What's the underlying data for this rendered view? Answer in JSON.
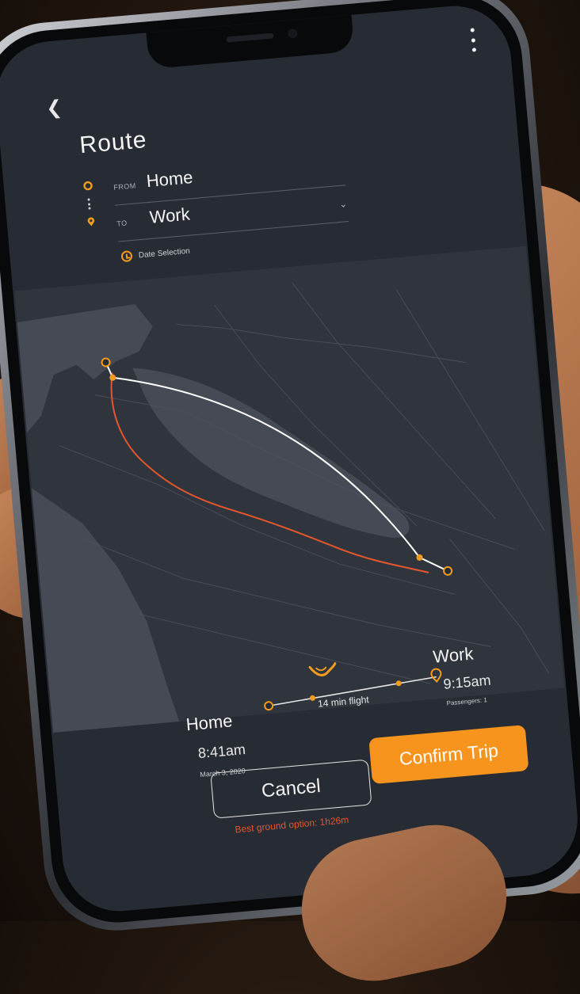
{
  "header": {
    "title": "Route"
  },
  "route": {
    "from_label": "FROM",
    "from_value": "Home",
    "to_label": "TO",
    "to_value": "Work",
    "date_selection": "Date Selection"
  },
  "trip": {
    "origin_name": "Home",
    "origin_time": "8:41am",
    "origin_date": "March 3, 2020",
    "flight_label": "14 min flight",
    "destination_name": "Work",
    "destination_time": "9:15am",
    "passengers": "Passengers: 1"
  },
  "actions": {
    "cancel_label": "Cancel",
    "confirm_label": "Confirm Trip"
  },
  "note": {
    "ground_option": "Best ground option: 1h26m"
  },
  "colors": {
    "accent": "#f7941d",
    "ground_route": "#e4572e",
    "flight_route": "#ffffff",
    "screen_bg": "#272b33",
    "land": "#2f343d",
    "water": "#454a54"
  },
  "icons": {
    "back": "back-arrow-icon",
    "menu": "kebab-menu-icon",
    "origin": "origin-ring-icon",
    "destination": "location-pin-icon",
    "clock": "clock-icon",
    "aircraft": "aircraft-logo-icon"
  }
}
